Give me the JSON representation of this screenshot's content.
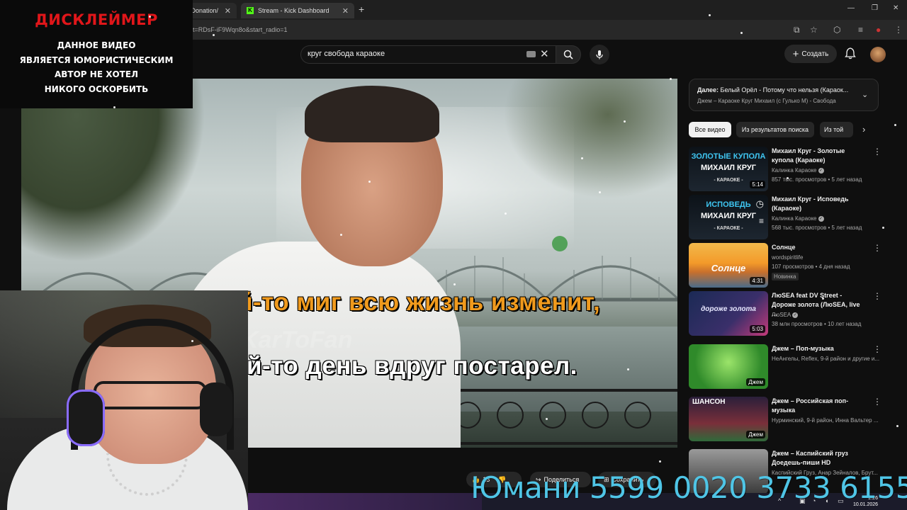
{
  "browser": {
    "tabs": [
      {
        "label": "- Donation/"
      },
      {
        "label": "Stream - Kick Dashboard"
      }
    ],
    "kick_icon_letter": "K",
    "url": "t=RDsF-iF9Wqn8o&start_radio=1"
  },
  "disclaimer": {
    "title": "ДИСКЛЕЙМЕР",
    "lines": [
      "ДАННОЕ ВИДЕО",
      "ЯВЛЯЕТСЯ ЮМОРИСТИЧЕСКИМ",
      "АВТОР НЕ ХОТЕЛ",
      "НИКОГО ОСКОРБИТЬ"
    ]
  },
  "youtube": {
    "search_query": "круг свобода  караоке",
    "create_label": "Создать"
  },
  "video": {
    "lyric_line_1": "Кто за какой-то миг всю жизнь изменит,",
    "lyric_line_2": "кто в какой-то день вдруг постарел.",
    "watermark": "KarToFan"
  },
  "up_next": {
    "label": "Далее:",
    "title": "Белый Орёл - Потому что нельзя (Караок...",
    "subtitle": "Джем – Караоке Круг Михаил (с Гулько М) - Свобода"
  },
  "chips": [
    "Все видео",
    "Из результатов поиска",
    "Из той"
  ],
  "recommendations": [
    {
      "title": "Михаил Круг - Золотые купола (Караоке)",
      "channel": "Калинка Караоке",
      "meta": "857 тыс. просмотров • 5 лет назад",
      "duration": "5:14",
      "thumb_text": [
        "ЗОЛОТЫЕ КУПОЛА",
        "МИХАИЛ КРУГ",
        "- КАРАОКЕ -"
      ]
    },
    {
      "title": "Михаил Круг - Исповедь (Караоке)",
      "channel": "Калинка Караоке",
      "meta": "568 тыс. просмотров • 5 лет назад",
      "duration": "",
      "thumb_text": [
        "ИСПОВЕДЬ",
        "МИХАИЛ КРУГ",
        "- КАРАОКЕ -"
      ]
    },
    {
      "title": "Солнце",
      "channel": "wordspiritlife",
      "meta": "107 просмотров • 4 дня назад",
      "badge": "Новинка",
      "duration": "4:31",
      "thumb_text": [
        "Солнце"
      ]
    },
    {
      "title": "ЛюSEA feat DV Street - Дороже золота (ЛюSEA, live ...",
      "channel": "ЛюSEA",
      "meta": "38 млн просмотров • 10 лет назад",
      "duration": "5:03",
      "thumb_text": [
        "дороже золота"
      ]
    },
    {
      "title": "Джем – Поп-музыка",
      "channel": "НеАнгелы, Reflex, 9-й район и другие и...",
      "meta": "",
      "duration": "Джем",
      "thumb_text": []
    },
    {
      "title": "Джем – Российская поп-музыка",
      "channel": "Нурминский, 9-й район, Инна Вальтер ...",
      "meta": "",
      "duration": "Джем",
      "thumb_text": [
        "ШАНСОН"
      ]
    },
    {
      "title": "Джем – Каспийский груз Доедешь-пиши HD",
      "channel": "Каспийский Груз, Анар Зейналов, Брут...",
      "meta": "",
      "duration": "",
      "thumb_text": []
    }
  ],
  "actions": {
    "likes": "13",
    "share": "Поделиться",
    "save": "Сохранить"
  },
  "donation_text": "Юмани 5599 0020 3733 6155",
  "clock": {
    "time": "2:26",
    "date": "10.01.2026"
  }
}
